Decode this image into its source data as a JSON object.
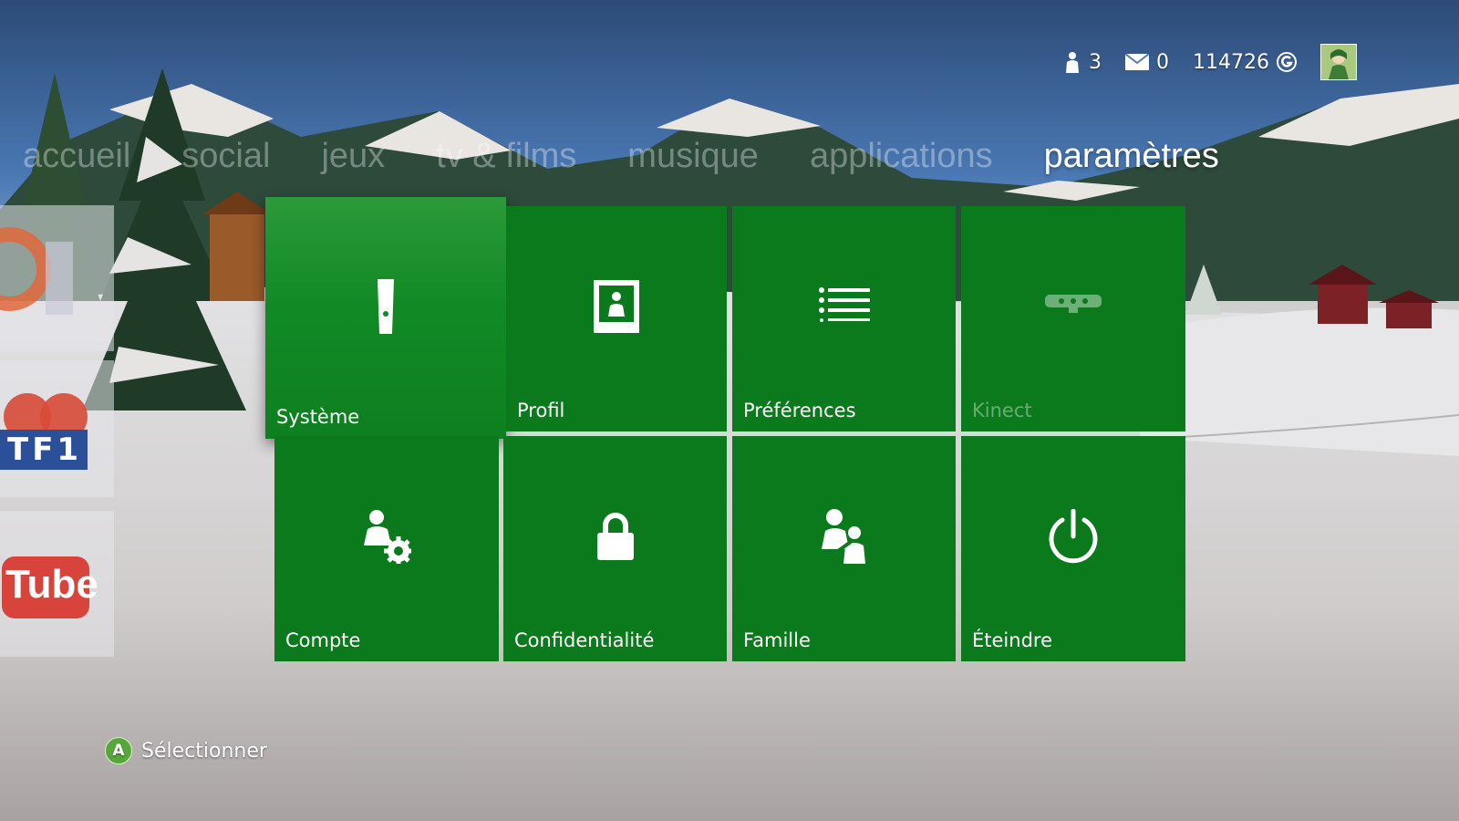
{
  "status": {
    "friends_count": "3",
    "messages_count": "0",
    "gamerscore": "114726",
    "gamerscore_icon": "gamerscore-icon"
  },
  "nav": {
    "tabs": [
      {
        "label": "accueil"
      },
      {
        "label": "social"
      },
      {
        "label": "jeux"
      },
      {
        "label": "tv & films"
      },
      {
        "label": "musique"
      },
      {
        "label": "applications"
      },
      {
        "label": "paramètres",
        "active": true
      }
    ]
  },
  "side": {
    "tile1_text": "TF1",
    "tile2_text": "Tube"
  },
  "tiles": [
    {
      "label": "Système",
      "icon": "console-icon"
    },
    {
      "label": "Profil",
      "icon": "profile-card-icon"
    },
    {
      "label": "Préférences",
      "icon": "list-icon"
    },
    {
      "label": "Kinect",
      "icon": "kinect-icon"
    },
    {
      "label": "Compte",
      "icon": "account-gear-icon"
    },
    {
      "label": "Confidentialité",
      "icon": "lock-icon"
    },
    {
      "label": "Famille",
      "icon": "family-icon"
    },
    {
      "label": "Éteindre",
      "icon": "power-icon"
    }
  ],
  "hint": {
    "button": "A",
    "label": "Sélectionner"
  },
  "colors": {
    "tile_green": "#0a7a1c",
    "tile_focus": "#2c9a3a",
    "sky_top": "#2f4d78",
    "a_button": "#57a83b"
  }
}
